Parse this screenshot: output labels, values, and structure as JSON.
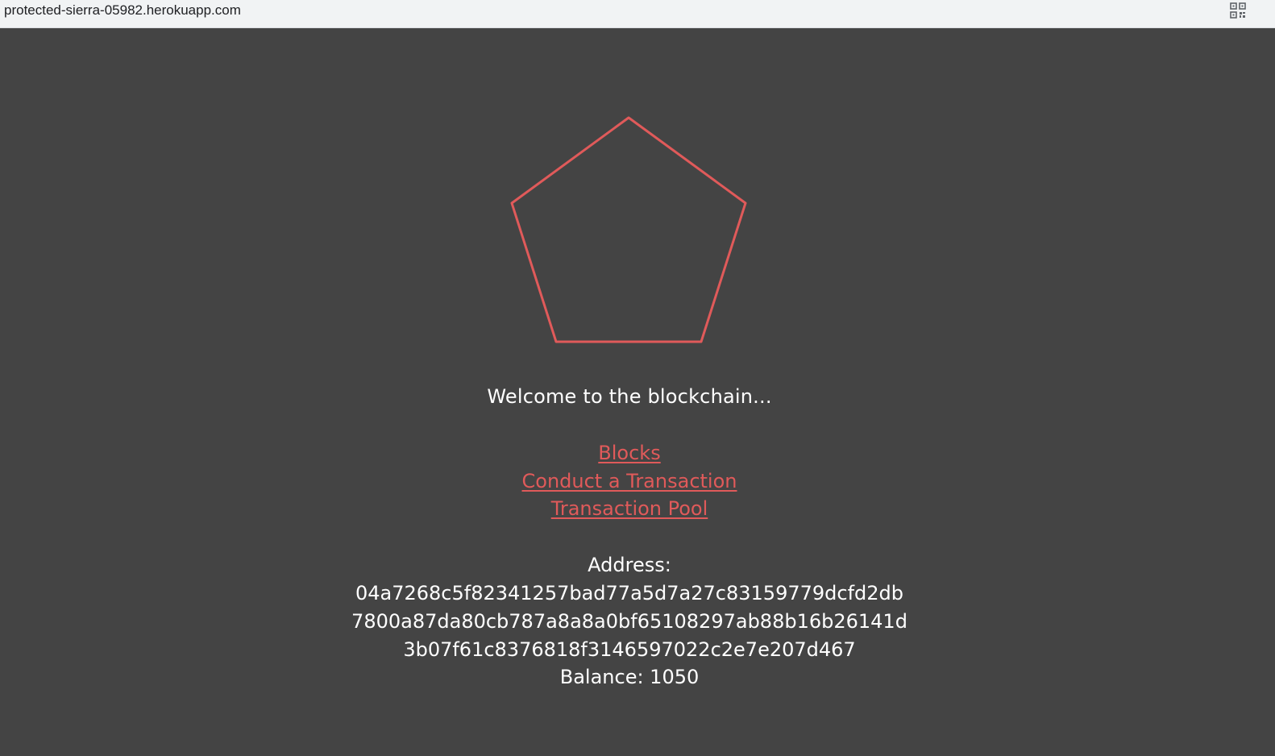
{
  "browser": {
    "url": "protected-sierra-05982.herokuapp.com"
  },
  "page": {
    "welcome_text": "Welcome to the blockchain...",
    "nav_links": [
      {
        "label": "Blocks"
      },
      {
        "label": "Conduct a Transaction"
      },
      {
        "label": "Transaction Pool"
      }
    ],
    "wallet": {
      "address_label": "Address:",
      "address_lines": [
        "04a7268c5f82341257bad77a5d7a27c83159779dcfd2db",
        "7800a87da80cb787a8a8a0bf65108297ab88b16b26141d",
        "3b07f61c8376818f3146597022c2e7e207d467"
      ],
      "balance_text": "Balance: 1050"
    }
  },
  "colors": {
    "background": "#444444",
    "accent": "#e05a5a",
    "text": "#ffffff"
  },
  "icons": {
    "logo": "pentagon-icon",
    "toolbar": "qr-code-icon"
  }
}
